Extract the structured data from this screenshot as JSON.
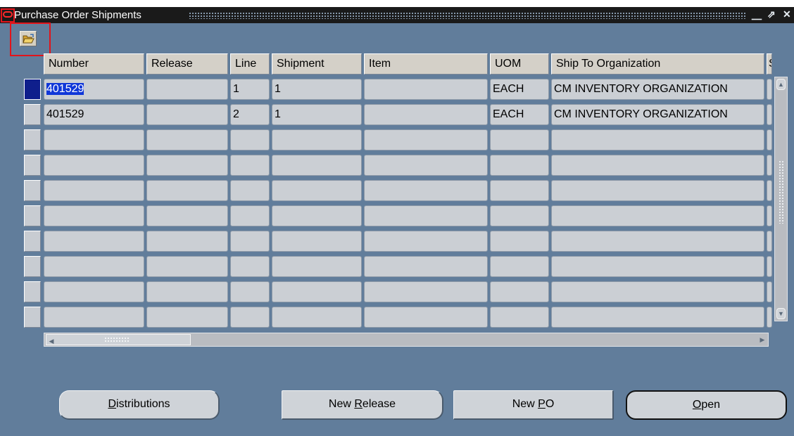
{
  "window": {
    "title": "Purchase Order Shipments",
    "controls": {
      "minimize": "⎽",
      "restore": "⇗",
      "close": "✕"
    }
  },
  "toolbar": {
    "open_folder_icon": "folder-open-icon"
  },
  "table": {
    "columns": [
      "Number",
      "Release",
      "Line",
      "Shipment",
      "Item",
      "UOM",
      "Ship To Organization",
      "S"
    ],
    "rows": [
      {
        "number": "401529",
        "release": "",
        "line": "1",
        "shipment": "1",
        "item": "",
        "uom": "EACH",
        "ship_to": "CM INVENTORY ORGANIZATION"
      },
      {
        "number": "401529",
        "release": "",
        "line": "2",
        "shipment": "1",
        "item": "",
        "uom": "EACH",
        "ship_to": "CM INVENTORY ORGANIZATION"
      },
      {
        "number": "",
        "release": "",
        "line": "",
        "shipment": "",
        "item": "",
        "uom": "",
        "ship_to": ""
      },
      {
        "number": "",
        "release": "",
        "line": "",
        "shipment": "",
        "item": "",
        "uom": "",
        "ship_to": ""
      },
      {
        "number": "",
        "release": "",
        "line": "",
        "shipment": "",
        "item": "",
        "uom": "",
        "ship_to": ""
      },
      {
        "number": "",
        "release": "",
        "line": "",
        "shipment": "",
        "item": "",
        "uom": "",
        "ship_to": ""
      },
      {
        "number": "",
        "release": "",
        "line": "",
        "shipment": "",
        "item": "",
        "uom": "",
        "ship_to": ""
      },
      {
        "number": "",
        "release": "",
        "line": "",
        "shipment": "",
        "item": "",
        "uom": "",
        "ship_to": ""
      },
      {
        "number": "",
        "release": "",
        "line": "",
        "shipment": "",
        "item": "",
        "uom": "",
        "ship_to": ""
      },
      {
        "number": "",
        "release": "",
        "line": "",
        "shipment": "",
        "item": "",
        "uom": "",
        "ship_to": ""
      }
    ]
  },
  "buttons": {
    "distributions": {
      "before": "",
      "mnemonic": "D",
      "after": "istributions"
    },
    "new_release": {
      "before": "New ",
      "mnemonic": "R",
      "after": "elease"
    },
    "new_po": {
      "before": "New ",
      "mnemonic": "P",
      "after": "O"
    },
    "open": {
      "before": "",
      "mnemonic": "O",
      "after": "pen"
    }
  },
  "colors": {
    "window_bg": "#617d9b",
    "titlebar_bg": "#1a1a1a",
    "highlight": "#e2141a",
    "selection": "#1037d8"
  }
}
